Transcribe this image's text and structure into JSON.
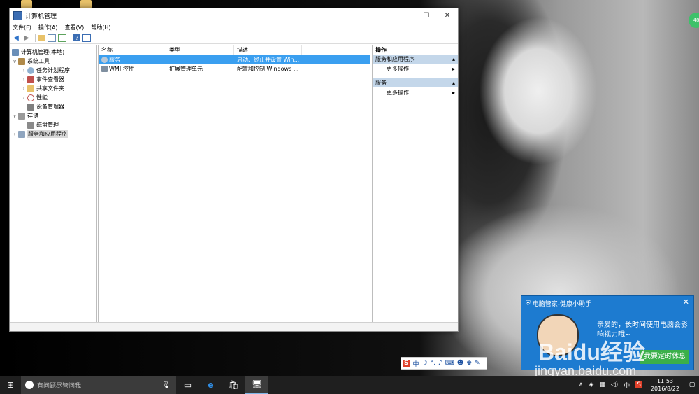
{
  "window": {
    "title": "计算机管理",
    "menu": [
      "文件(F)",
      "操作(A)",
      "查看(V)",
      "帮助(H)"
    ]
  },
  "tree": {
    "root": "计算机管理(本地)",
    "system_tools": "系统工具",
    "task_scheduler": "任务计划程序",
    "event_viewer": "事件查看器",
    "shared_folders": "共享文件夹",
    "performance": "性能",
    "device_manager": "设备管理器",
    "storage": "存储",
    "disk_management": "磁盘管理",
    "services_apps": "服务和应用程序"
  },
  "list": {
    "columns": [
      "名称",
      "类型",
      "描述"
    ],
    "rows": [
      {
        "name": "服务",
        "type": "",
        "desc": "启动、终止并设置 Win..."
      },
      {
        "name": "WMI 控件",
        "type": "扩展管理单元",
        "desc": "配置和控制 Windows ..."
      }
    ]
  },
  "actions": {
    "header": "操作",
    "section1": "服务和应用程序",
    "more1": "更多操作",
    "section2": "服务",
    "more2": "更多操作"
  },
  "popup": {
    "title": "电脑管家-健康小助手",
    "message": "亲爱的，长时间使用电脑会影响视力哦~",
    "button": "我要定时休息"
  },
  "watermark": {
    "logo": "Baidu经验",
    "url": "jingyan.baidu.com"
  },
  "ime": {
    "brand": "S",
    "mode": "中"
  },
  "taskbar": {
    "search_placeholder": "有问题尽管问我",
    "ime_lang": "中",
    "time": "11:53",
    "date": "2016/8/22"
  },
  "float_ball": "48",
  "colors": {
    "selection": "#3a9ff0",
    "action_section": "#c4d7ea",
    "popup": "#1d7bd0",
    "popup_button": "#3bb04a",
    "taskbar": "#1f1f1f"
  }
}
